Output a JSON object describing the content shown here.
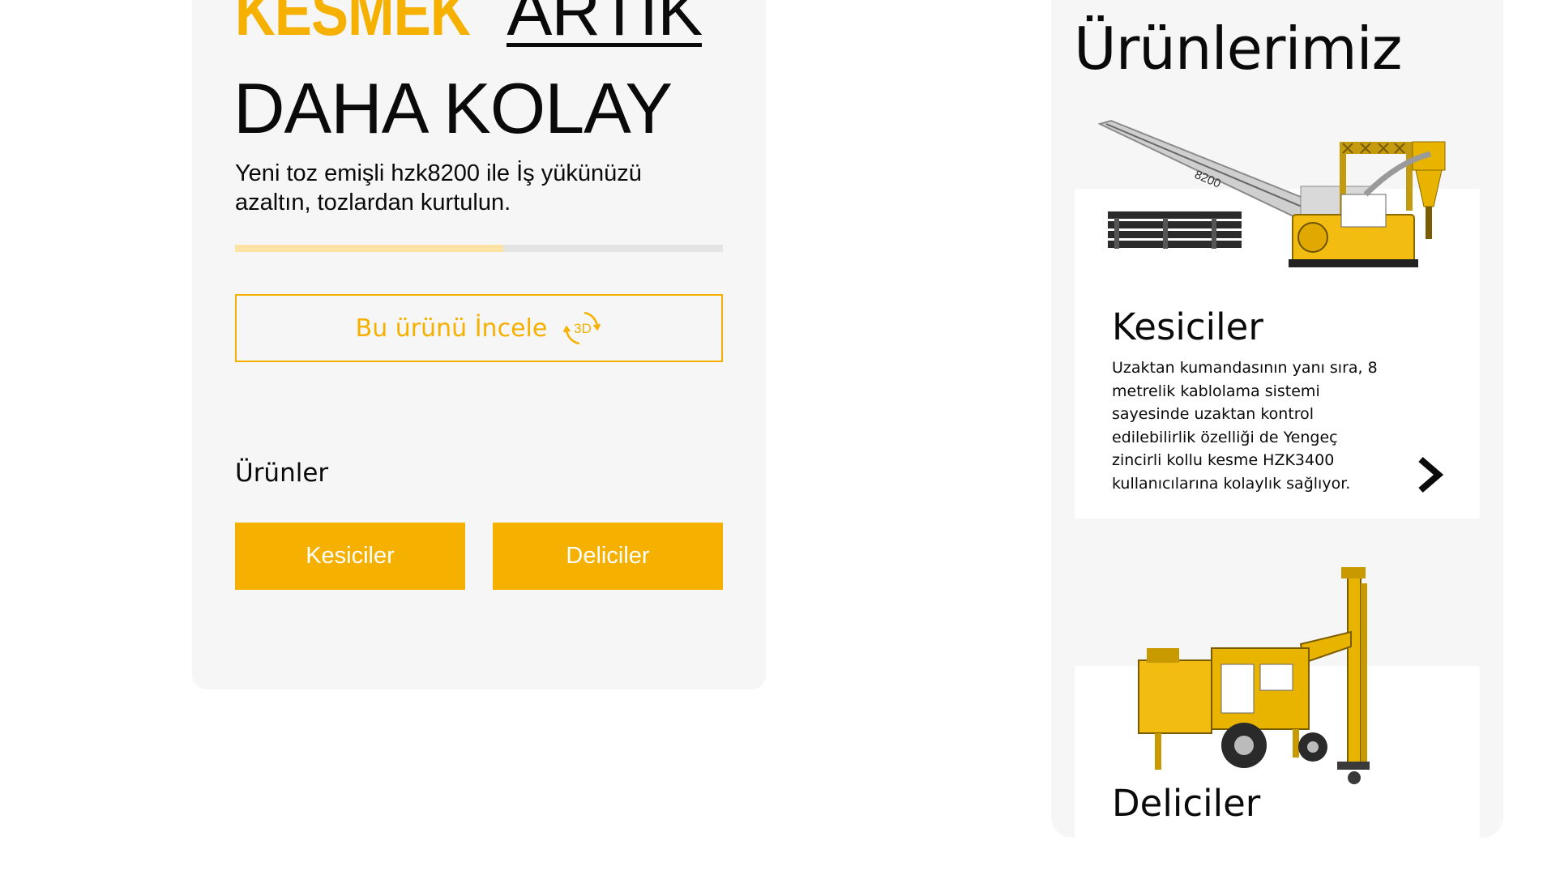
{
  "hero": {
    "headline_yellow": "KESMEK",
    "headline_underlined": "ARTIK",
    "headline_line2": "DAHA KOLAY",
    "subtitle": "Yeni toz emişli hzk8200 ile İş yükünüzü azaltın, tozlardan kurtulun.",
    "progress_fraction": 0.55,
    "explore_button": "Bu ürünü İncele",
    "explore_icon": "rotate-3d-icon",
    "icon_text": "3D",
    "products_label": "Ürünler",
    "category_buttons": [
      "Kesiciler",
      "Deliciler"
    ]
  },
  "products_panel": {
    "title": "Ürünlerimiz",
    "items": [
      {
        "name": "Kesiciler",
        "description": "Uzaktan kumandasının yanı sıra, 8 metrelik kablolama sistemi sayesinde uzaktan kontrol edilebilirlik özelliği de Yengeç zincirli kollu kesme HZK3400 kullanıcılarına kolaylık sağlıyor.",
        "image_text": "8200",
        "image": "chain-saw-cutter-machine-image",
        "action_icon": "chevron-right-icon"
      },
      {
        "name": "Deliciler",
        "image": "drilling-rig-machine-image"
      }
    ]
  },
  "colors": {
    "accent": "#f5b000",
    "accent_light": "#fde3a3",
    "card_bg": "#f6f6f6",
    "text": "#0a0a0a"
  }
}
